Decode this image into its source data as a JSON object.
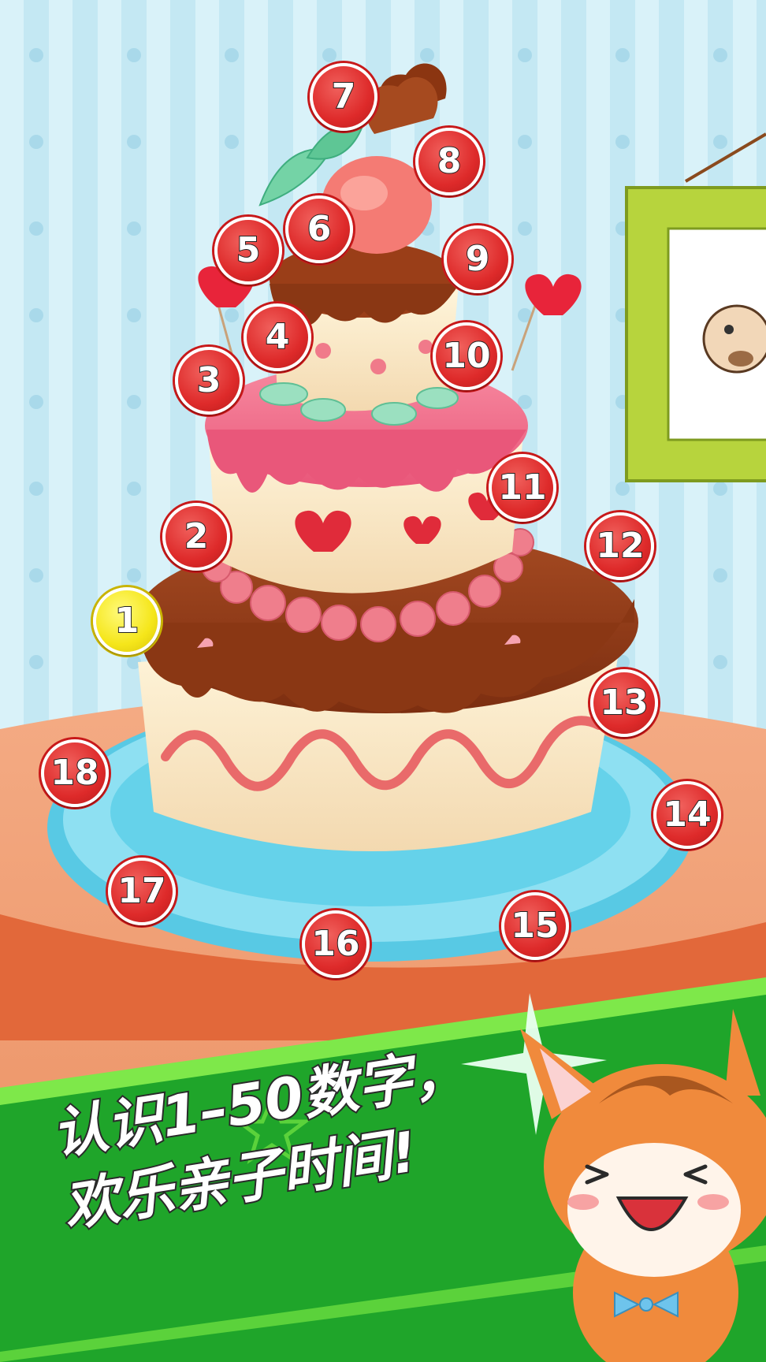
{
  "game": {
    "tagline_line1": "认识1–50数字，",
    "tagline_line2": "欢乐亲子时间!",
    "current_dot": "1",
    "dots": [
      "1",
      "2",
      "3",
      "4",
      "5",
      "6",
      "7",
      "8",
      "9",
      "10",
      "11",
      "12",
      "13",
      "14",
      "15",
      "16",
      "17",
      "18"
    ]
  },
  "colors": {
    "wall": "#bfe6f2",
    "wall_stripe": "#d8f1f8",
    "table": "#f0a27a",
    "table_edge": "#e1683a",
    "plate": "#7fdcef",
    "banner": "#22b52c",
    "dot_red": "#de2a2a",
    "dot_active": "#f5e61a"
  }
}
